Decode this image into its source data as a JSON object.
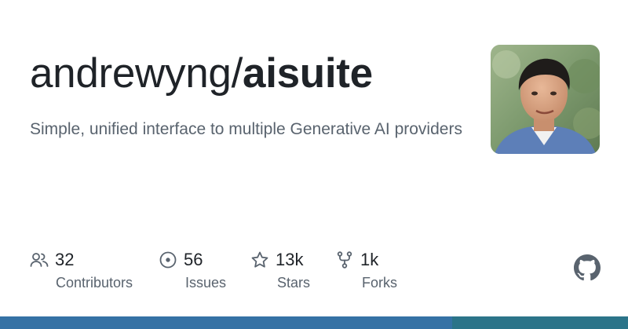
{
  "repo": {
    "owner": "andrewyng/",
    "name": "aisuite",
    "description": "Simple, unified interface to multiple Generative AI providers"
  },
  "stats": [
    {
      "icon": "people-icon",
      "value": "32",
      "label": "Contributors"
    },
    {
      "icon": "issue-icon",
      "value": "56",
      "label": "Issues"
    },
    {
      "icon": "star-icon",
      "value": "13k",
      "label": "Stars"
    },
    {
      "icon": "fork-icon",
      "value": "1k",
      "label": "Forks"
    }
  ],
  "language_bar": {
    "segments": [
      {
        "color": "#3572a5",
        "fraction": 0.72
      },
      {
        "color": "#2b7489",
        "fraction": 0.28
      }
    ]
  },
  "icons": {
    "logo": "github-mark-icon",
    "avatar": "owner-avatar"
  }
}
